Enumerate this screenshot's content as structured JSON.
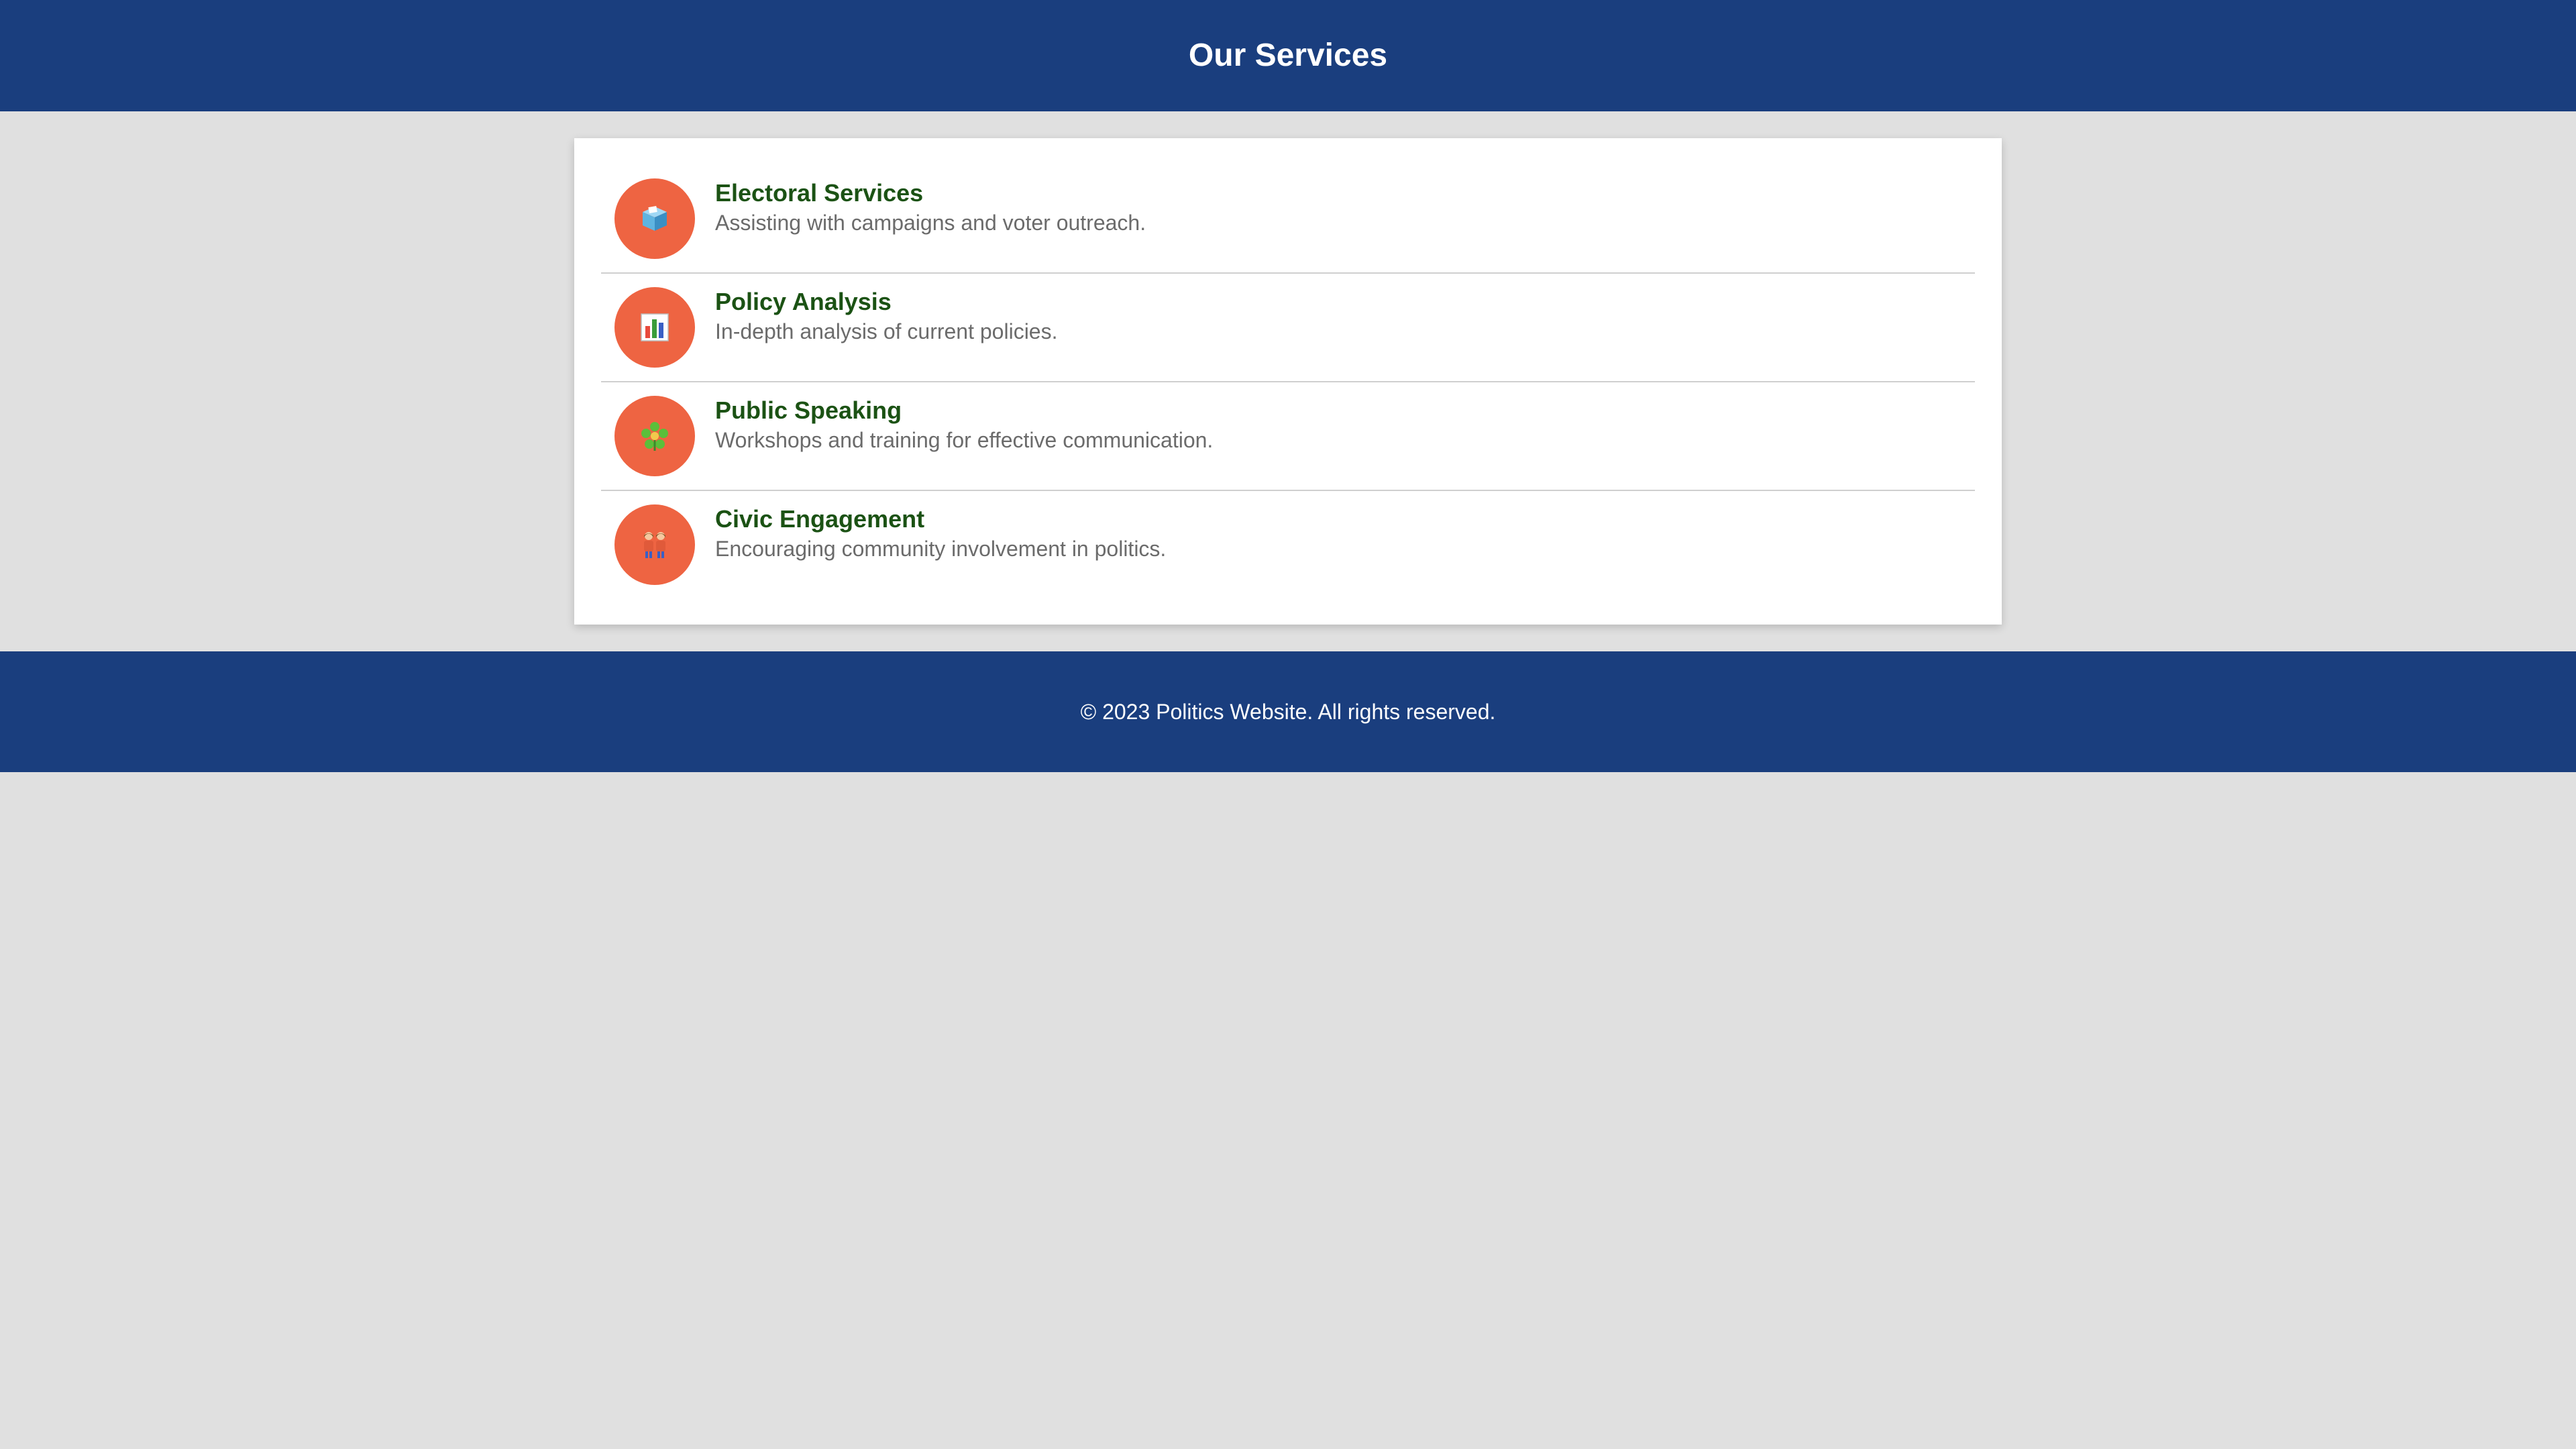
{
  "header": {
    "title": "Our Services"
  },
  "services": [
    {
      "icon": "ballot-box-icon",
      "title": "Electoral Services",
      "description": "Assisting with campaigns and voter outreach."
    },
    {
      "icon": "bar-chart-icon",
      "title": "Policy Analysis",
      "description": "In-depth analysis of current policies."
    },
    {
      "icon": "speaker-flower-icon",
      "title": "Public Speaking",
      "description": "Workshops and training for effective communication."
    },
    {
      "icon": "people-icon",
      "title": "Civic Engagement",
      "description": "Encouraging community involvement in politics."
    }
  ],
  "footer": {
    "text": "© 2023 Politics Website. All rights reserved."
  },
  "colors": {
    "header_bg": "#1a3e7e",
    "page_bg": "#e0e0e0",
    "icon_bg": "#ee6442",
    "title_text": "#1b5214",
    "description_text": "#6b6b6b"
  }
}
